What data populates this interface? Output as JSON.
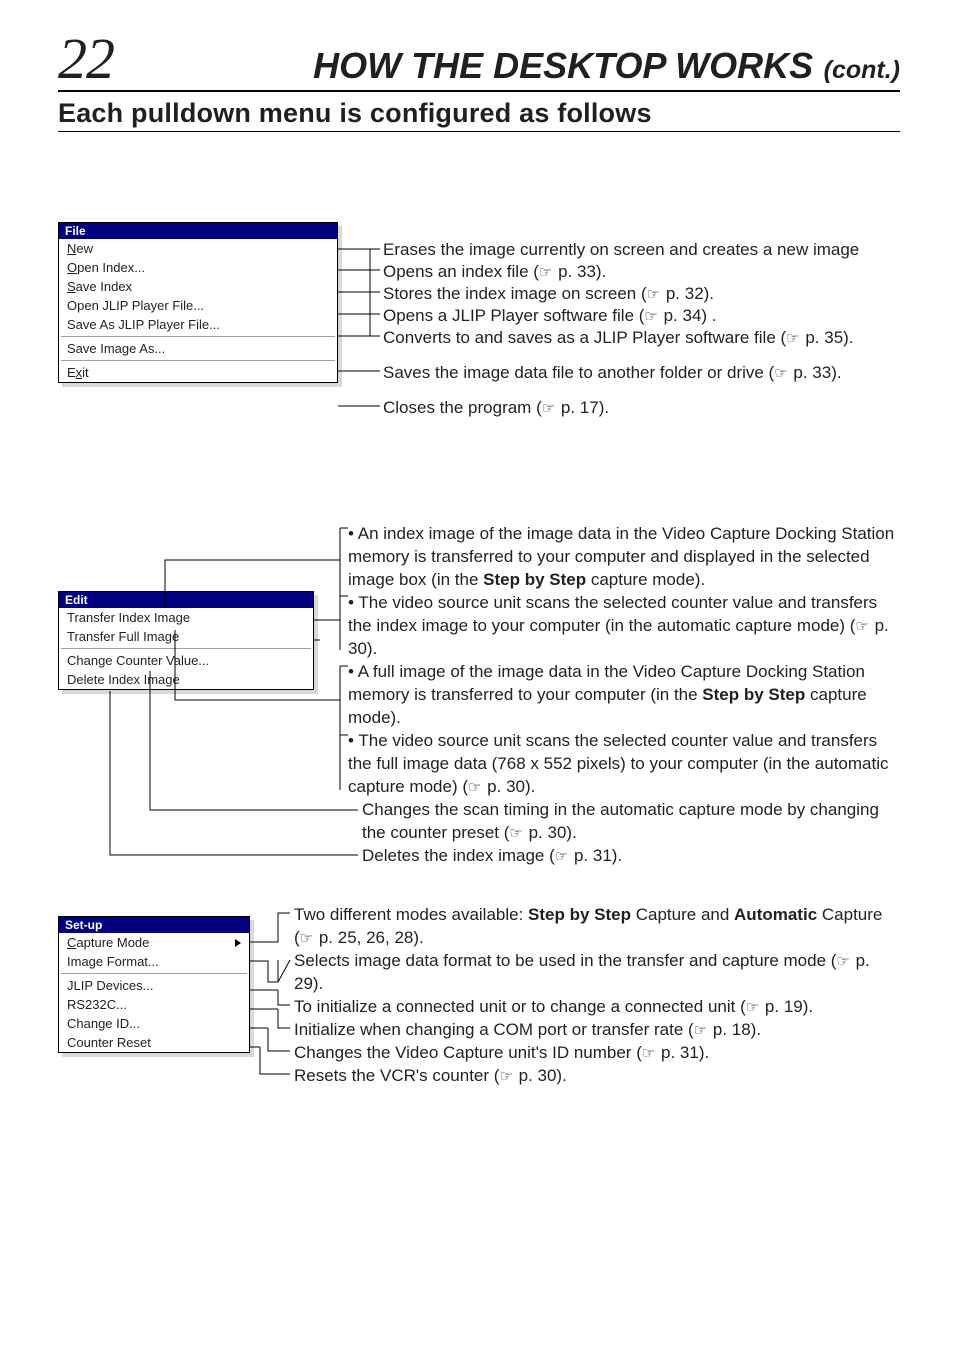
{
  "header": {
    "page_number": "22",
    "title": "HOW THE DESKTOP WORKS",
    "cont": "(cont.)",
    "subtitle": "Each pulldown menu is configured as follows"
  },
  "file_menu": {
    "title": "File",
    "items": [
      {
        "label": "New"
      },
      {
        "label": "Open Index..."
      },
      {
        "label": "Save Index"
      },
      {
        "label": "Open JLIP Player File..."
      },
      {
        "label": "Save As JLIP Player File..."
      }
    ],
    "items2": [
      {
        "label": "Save Image As..."
      }
    ],
    "items3": [
      {
        "label": "Exit"
      }
    ]
  },
  "file_desc": {
    "d1": "Erases the image currently on screen and creates a new image",
    "d2a": "Opens an index file (",
    "d2b": " p. 33).",
    "d3a": "Stores the index image on screen (",
    "d3b": " p. 32).",
    "d4a": "Opens a JLIP Player software file (",
    "d4b": " p. 34) .",
    "d5a": "Converts to and saves as a JLIP Player software file (",
    "d5b": " p. 35).",
    "d6a": "Saves the image data file to another folder or drive (",
    "d6b": " p. 33).",
    "d7a": "Closes the program (",
    "d7b": " p. 17)."
  },
  "edit_menu": {
    "title": "Edit",
    "items": [
      {
        "label": "Transfer Index Image"
      },
      {
        "label": "Transfer Full Image"
      },
      {
        "label": "Change Counter Value..."
      },
      {
        "label": "Delete Index Image"
      }
    ]
  },
  "edit_desc": {
    "b1": "An index image of the image data in the Video Capture Docking Station memory is transferred to your computer and displayed in the selected image box (in the ",
    "b1b": "Step by Step",
    "b1c": " capture mode).",
    "b2a": "The video source unit scans the selected counter value and transfers the index image to your computer (in the automatic capture mode) (",
    "b2b": " p. 30).",
    "b3a": "A full image of the image data in the Video Capture Docking Station memory is transferred to your computer (in the ",
    "b3b": "Step by Step",
    "b3c": " capture mode).",
    "b4a": "The video source unit scans the selected counter value and transfers the full image data (768 x 552 pixels) to your computer (in the automatic capture mode) (",
    "b4b": " p. 30).",
    "b5a": "Changes the scan timing in the automatic capture mode by changing the counter preset (",
    "b5b": " p. 30).",
    "b6a": "Deletes the index image (",
    "b6b": " p. 31)."
  },
  "setup_menu": {
    "title": "Set-up",
    "items": [
      {
        "label": "Capture Mode"
      },
      {
        "label": "Image Format..."
      },
      {
        "label": "JLIP Devices..."
      },
      {
        "label": "RS232C..."
      },
      {
        "label": "Change ID..."
      },
      {
        "label": "Counter Reset"
      }
    ]
  },
  "setup_desc": {
    "d1a": "Two different modes available: ",
    "d1b": "Step by Step",
    "d1c": " Capture and ",
    "d1d": "Automatic",
    "d1e": " Capture (",
    "d1f": " p. 25, 26, 28).",
    "d2a": "Selects image data format to be used in the transfer and capture mode (",
    "d2b": " p. 29).",
    "d3a": "To initialize a connected unit or to change a connected unit (",
    "d3b": " p. 19).",
    "d4a": "Initialize when changing a COM port or transfer rate (",
    "d4b": " p. 18).",
    "d5a": "Changes the Video Capture unit's ID number (",
    "d5b": " p. 31).",
    "d6a": "Resets the VCR's counter (",
    "d6b": " p. 30)."
  }
}
